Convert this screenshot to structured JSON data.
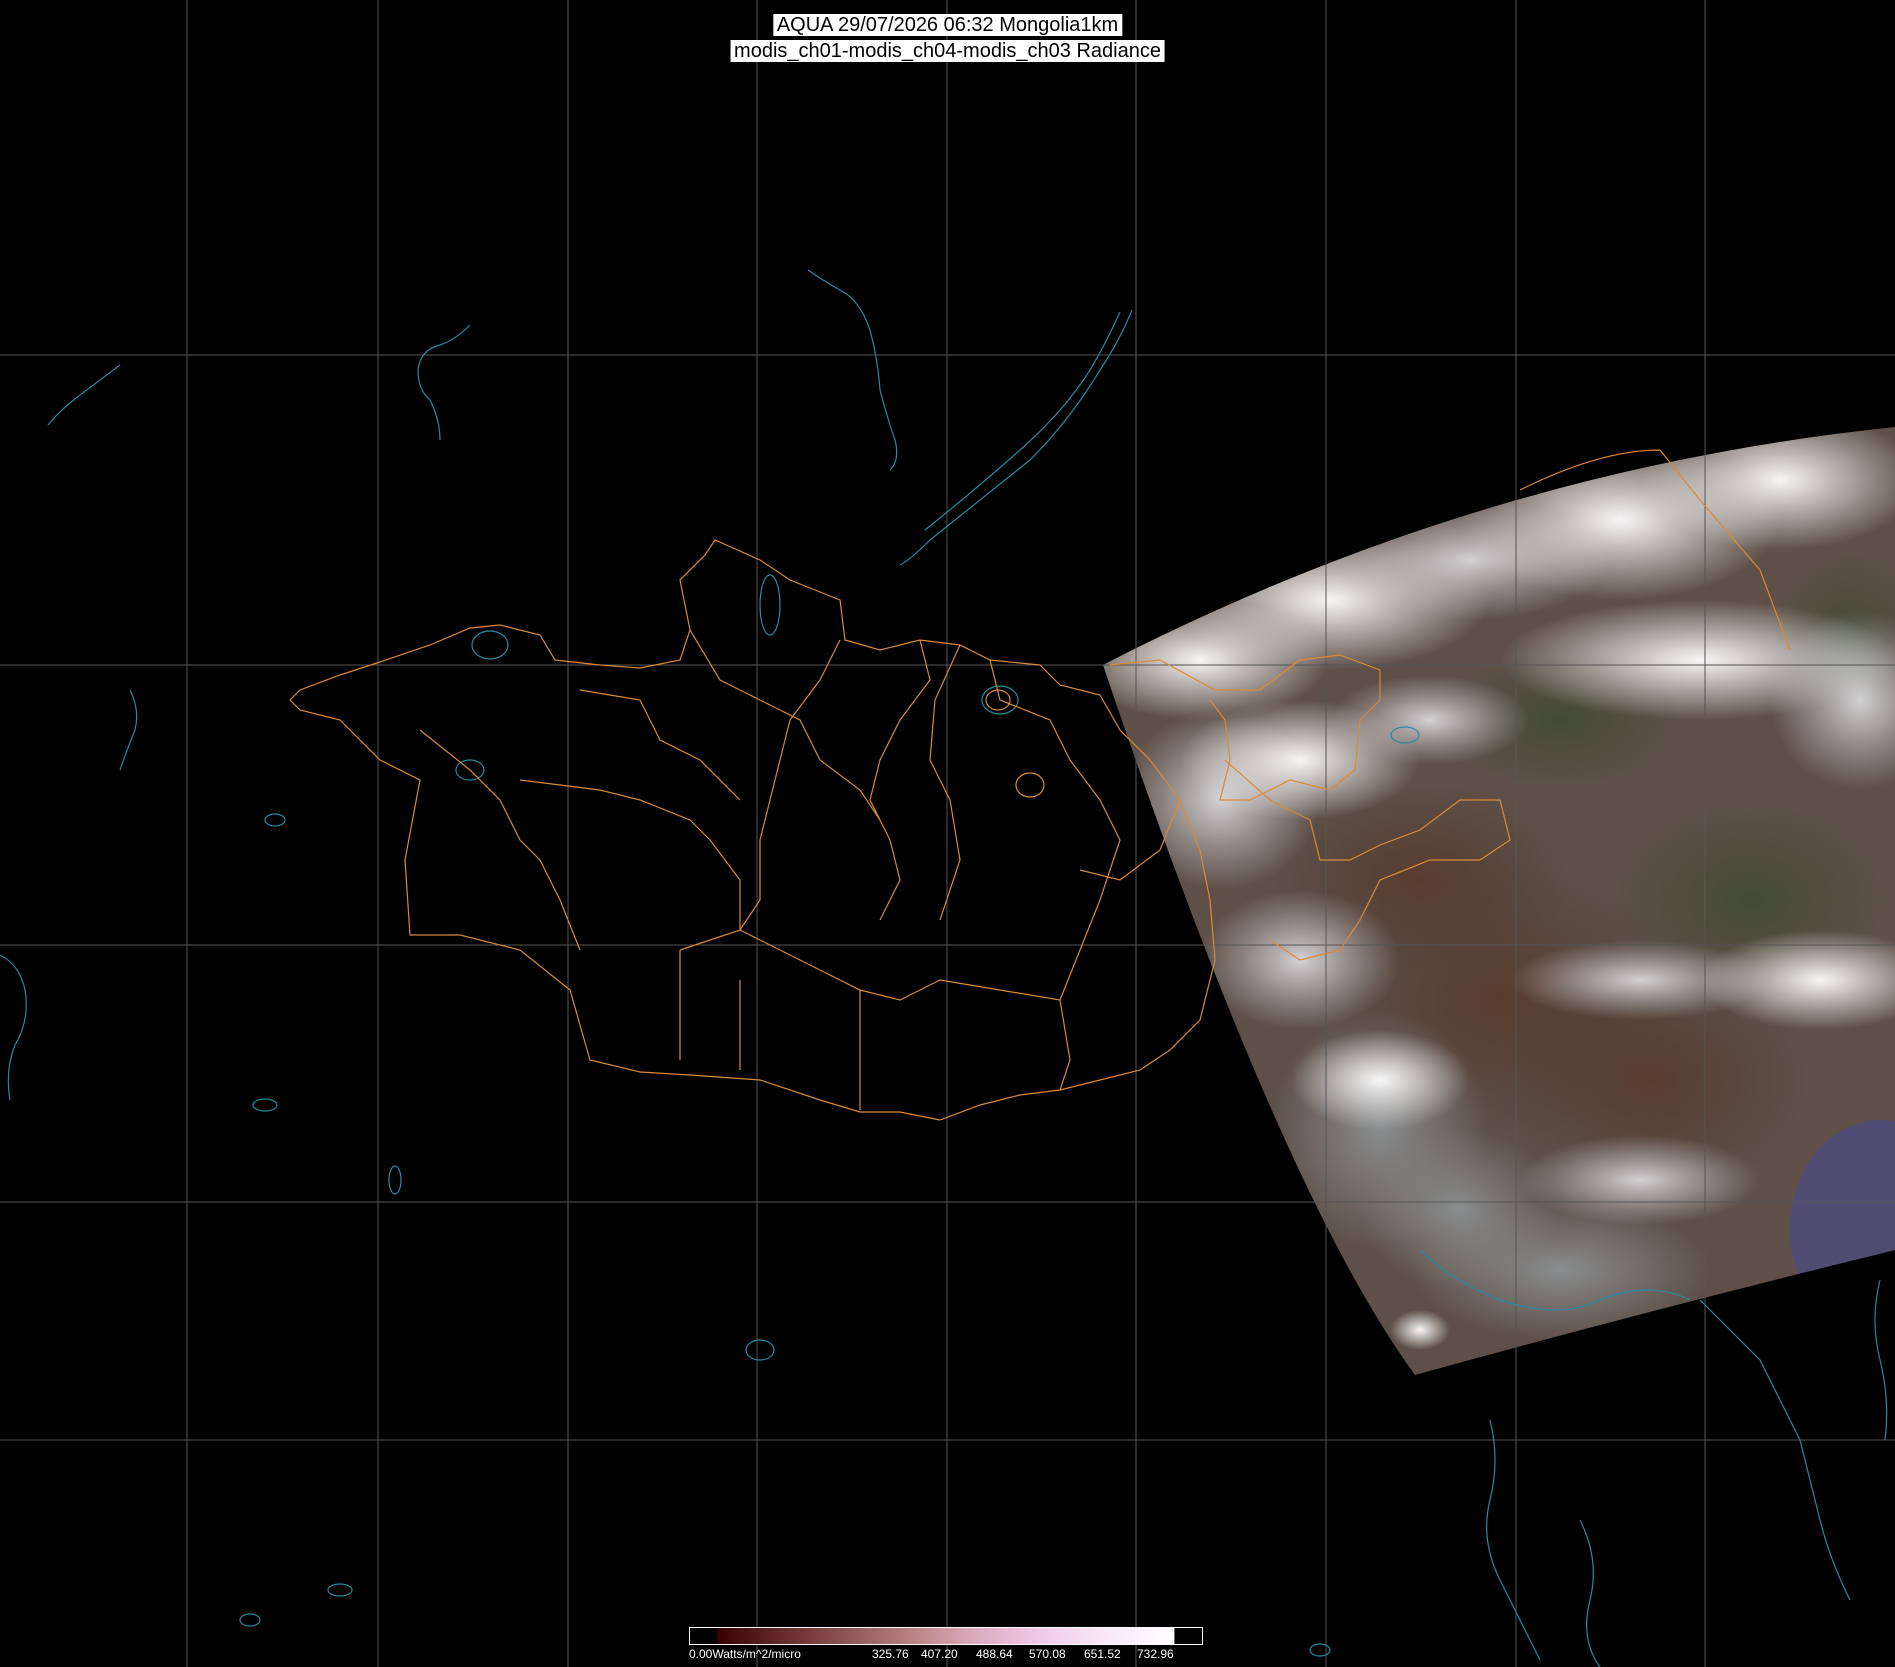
{
  "title": {
    "line1": "AQUA 29/07/2026 06:32 Mongolia1km",
    "line2": "modis_ch01-modis_ch04-modis_ch03 Radiance"
  },
  "colors": {
    "background": "#000000",
    "graticule": "#555555",
    "coastline": "#2a8aa0",
    "admin_borders": "#d98a3a",
    "title_bg": "#ffffff"
  },
  "colorbar": {
    "labels": [
      "0.00Watts/m^2/micro",
      "325.76",
      "407.20",
      "488.64",
      "570.08",
      "651.52",
      "732.96"
    ],
    "colors": [
      "#3a0000",
      "#6e2a2a",
      "#a25a5a",
      "#c98a8a",
      "#e8b8c8",
      "#f0d0e8",
      "#ffffff"
    ]
  },
  "layers": {
    "imagery": "true-color swath (clouds, land)",
    "boundaries": "Mongolia aimag borders",
    "coastlines": "lakes, rivers, coastlines"
  }
}
